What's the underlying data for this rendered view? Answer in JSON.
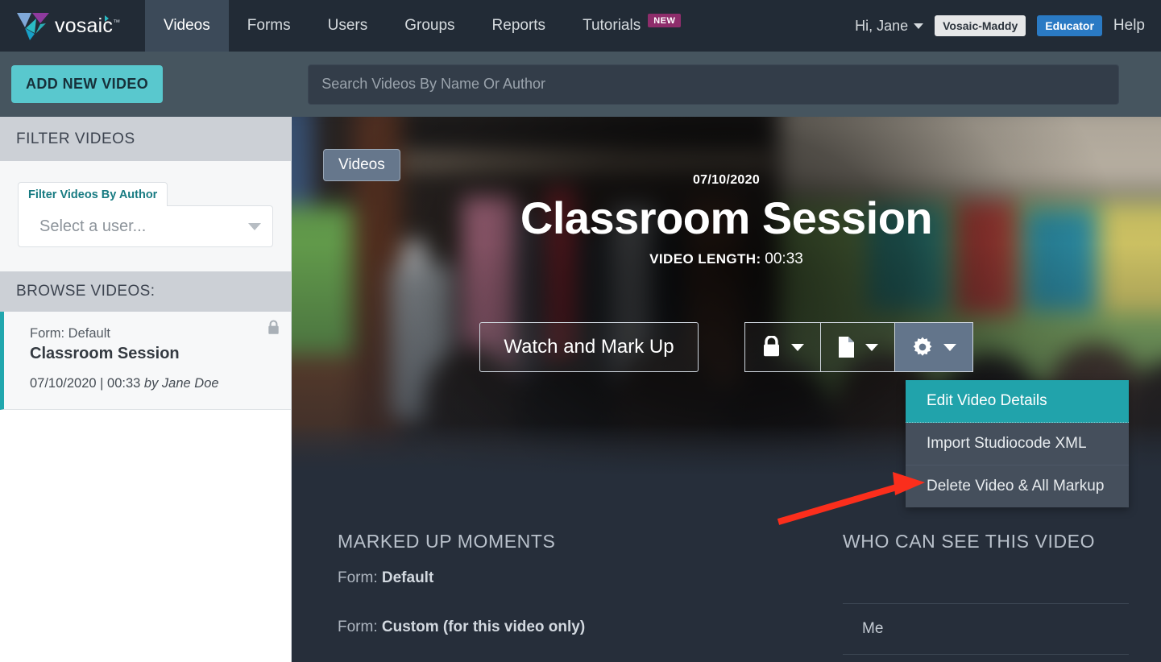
{
  "nav": {
    "logo_text": "vosaic",
    "logo_tm": "™",
    "links": [
      {
        "label": "Videos",
        "active": true
      },
      {
        "label": "Forms",
        "active": false
      },
      {
        "label": "Users",
        "active": false
      },
      {
        "label": "Groups",
        "active": false
      },
      {
        "label": "Reports",
        "active": false
      },
      {
        "label": "Tutorials",
        "active": false,
        "badge": "NEW"
      }
    ],
    "user_greeting": "Hi, Jane",
    "org_badge": "Vosaic-Maddy",
    "role_badge": "Educator",
    "help": "Help"
  },
  "subbar": {
    "add_video_label": "ADD NEW VIDEO",
    "search_placeholder": "Search Videos By Name Or Author",
    "search_value": ""
  },
  "sidebar": {
    "filter_header": "FILTER VIDEOS",
    "filter_tab_label": "Filter Videos By Author",
    "filter_select_value": "Select a user...",
    "browse_header": "BROWSE VIDEOS:",
    "videos": [
      {
        "form": "Form: Default",
        "title": "Classroom Session",
        "meta": "07/10/2020 | 00:33 ",
        "author": "by Jane Doe",
        "locked": true
      }
    ]
  },
  "hero": {
    "breadcrumb_button": "Videos",
    "date": "07/10/2020",
    "title": "Classroom Session",
    "length_label": "VIDEO LENGTH:",
    "length_value": "00:33",
    "watch_button": "Watch and Mark Up",
    "icon_buttons": [
      {
        "icon": "lock-icon",
        "active": false
      },
      {
        "icon": "document-icon",
        "active": false
      },
      {
        "icon": "gear-icon",
        "active": true
      }
    ]
  },
  "dropdown": {
    "items": [
      {
        "label": "Edit Video Details",
        "selected": true
      },
      {
        "label": "Import Studiocode XML",
        "selected": false
      },
      {
        "label": "Delete Video & All Markup",
        "selected": false
      }
    ]
  },
  "marked_up": {
    "title": "MARKED UP MOMENTS",
    "rows": [
      {
        "prefix": "Form: ",
        "value": "Default"
      },
      {
        "prefix": "Form: ",
        "value": "Custom (for this video only)"
      }
    ]
  },
  "visibility": {
    "title": "WHO CAN SEE THIS VIDEO",
    "viewers": [
      "Me"
    ]
  },
  "annotation": {
    "arrow_color": "#fb2e1c"
  },
  "colors": {
    "nav_bg": "#222b36",
    "subbar_bg": "#46555f",
    "teal_accent": "#21a7ae",
    "add_button": "#59c8ce",
    "role_badge": "#2a7ac4",
    "new_badge": "#8e2d6b",
    "panel_bg": "#262e3a"
  }
}
